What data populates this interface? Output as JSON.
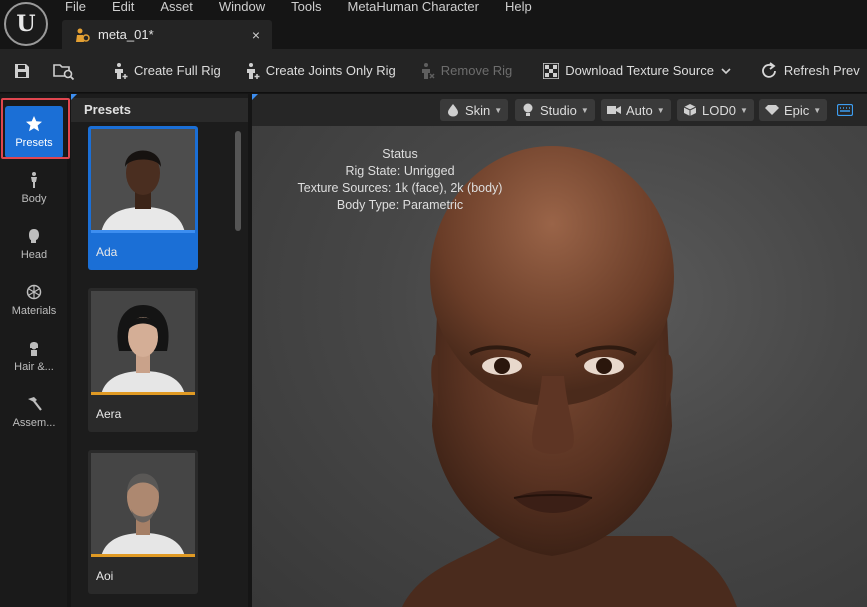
{
  "menu": [
    "File",
    "Edit",
    "Asset",
    "Window",
    "Tools",
    "MetaHuman Character",
    "Help"
  ],
  "tab": {
    "label": "meta_01*",
    "close": "×"
  },
  "toolbar": {
    "create_full_rig": "Create Full Rig",
    "create_joints_only_rig": "Create Joints Only Rig",
    "remove_rig": "Remove Rig",
    "download_texture_source": "Download Texture Source",
    "refresh_preview": "Refresh Prev"
  },
  "rail": {
    "presets": "Presets",
    "body": "Body",
    "head": "Head",
    "materials": "Materials",
    "hair": "Hair &...",
    "assembly": "Assem..."
  },
  "panel": {
    "title": "Presets",
    "presets": [
      {
        "name": "Ada",
        "selected": true
      },
      {
        "name": "Aera",
        "selected": false
      },
      {
        "name": "Aoi",
        "selected": false
      }
    ]
  },
  "viewport": {
    "skin": "Skin",
    "studio": "Studio",
    "auto": "Auto",
    "lod": "LOD0",
    "quality": "Epic",
    "status": {
      "title": "Status",
      "rig_state": "Rig State: Unrigged",
      "texture_sources": "Texture Sources: 1k (face), 2k (body)",
      "body_type": "Body Type: Parametric"
    }
  },
  "colors": {
    "accent": "#1b6fd6",
    "highlight": "#e0464f",
    "preset_bar": "#e09a24"
  }
}
